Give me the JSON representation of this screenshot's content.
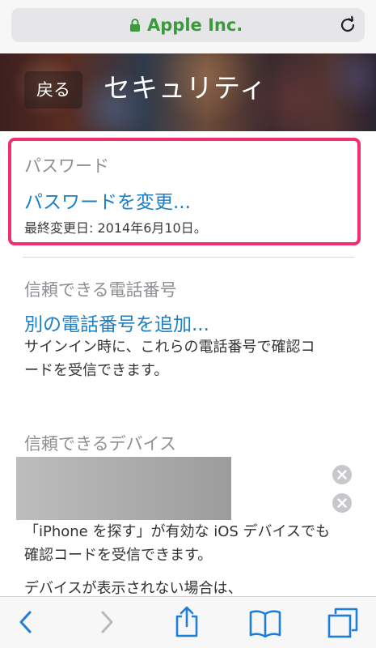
{
  "browser": {
    "url_host": "Apple Inc.",
    "icons": {
      "lock": "lock-icon",
      "reload": "reload-icon"
    },
    "accent_secure": "#3c9a3c"
  },
  "header": {
    "back_label": "戻る",
    "title": "セキュリティ"
  },
  "password_section": {
    "title": "パスワード",
    "change_link": "パスワードを変更...",
    "last_changed": "最終変更日: 2014年6月10日。",
    "highlight_color": "#f0306e"
  },
  "trusted_phone": {
    "title": "信頼できる電話番号",
    "add_link": "別の電話番号を追加...",
    "description_line1": "サインイン時に、これらの電話番号で確認コ",
    "description_line2": "ードを受信できます。"
  },
  "trusted_devices": {
    "title": "信頼できるデバイス",
    "description_line1": "「iPhone を探す」が有効な iOS デバイスでも",
    "description_line2": "確認コードを受信できます。",
    "description_line3": "デバイスが表示されない場合は、"
  },
  "toolbar": {
    "icons": [
      "back-icon",
      "forward-icon",
      "share-icon",
      "bookmarks-icon",
      "tabs-icon"
    ],
    "tint": "#1e7fd9"
  },
  "link_color": "#1e7fc4"
}
